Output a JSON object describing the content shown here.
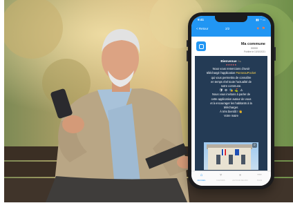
{
  "app": {
    "status_time": "9:41",
    "status_icons": "▮▮ ◠ ▭",
    "back_label": "< Retour",
    "page_count": "2/2",
    "header_icons": "♥ ⚑",
    "accent_color": "#2196f3"
  },
  "post": {
    "commune_name": "Ma commune",
    "commune_code": "00000",
    "published": "Publiée le 10/10/2021",
    "welcome": "Bienvenue 🐜",
    "deco_top": "★★★★★",
    "lines": [
      "Nous vous remercions d'avoir",
      "téléchargé l'application",
      "qui vous permettra de connaître",
      "en temps réel toute l'actualité de",
      "notre commune."
    ],
    "app_link": "PanneauPocket",
    "emoji_row": "🛡 ⚙ 🎭 ⛳ ⚠",
    "invite_lines": [
      "Nous vous invitons à parler de",
      "cette application autour de vous",
      "et à encourager les habitants à la",
      "télécharger."
    ],
    "signoff": "À très bientôt ! 👋",
    "signature": "Votre maire"
  },
  "tabs": [
    {
      "label": "ACCUEIL",
      "icon": "home-icon",
      "glyph": "⌂"
    },
    {
      "label": "FAVORIS",
      "icon": "heart-icon",
      "glyph": "♥"
    },
    {
      "label": "AUTOUR DE MOI",
      "icon": "location-icon",
      "glyph": "●"
    },
    {
      "label": "PLUS",
      "icon": "more-icon",
      "glyph": "•••"
    }
  ]
}
